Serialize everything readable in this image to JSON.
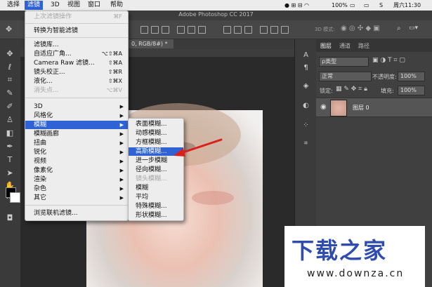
{
  "menubar": {
    "items": [
      "选择",
      "滤镜",
      "3D",
      "视图",
      "窗口",
      "帮助"
    ],
    "status": {
      "battery": "100%",
      "clock": "周六11:30"
    }
  },
  "window": {
    "title": "Adobe Photoshop CC 2017"
  },
  "optionsbar": {
    "mode3d": "3D 模式:"
  },
  "document": {
    "tab_label": "0, RGB/8#) *"
  },
  "filter_menu": {
    "items": [
      {
        "label": "上次滤镜操作",
        "shortcut": "⌘F",
        "state": "disabled"
      },
      {
        "label": "转换为智能滤镜",
        "state": "normal"
      },
      {
        "label": "滤镜库...",
        "state": "normal"
      },
      {
        "label": "自适应广角...",
        "shortcut": "⌥⇧⌘A",
        "state": "normal"
      },
      {
        "label": "Camera Raw 滤镜...",
        "shortcut": "⇧⌘A",
        "state": "normal"
      },
      {
        "label": "镜头校正...",
        "shortcut": "⇧⌘R",
        "state": "normal"
      },
      {
        "label": "液化...",
        "shortcut": "⇧⌘X",
        "state": "normal"
      },
      {
        "label": "消失点...",
        "shortcut": "⌥⌘V",
        "state": "disabled"
      },
      {
        "label": "3D",
        "submenu": true,
        "state": "normal"
      },
      {
        "label": "风格化",
        "submenu": true,
        "state": "normal"
      },
      {
        "label": "模糊",
        "submenu": true,
        "state": "selected"
      },
      {
        "label": "模糊画廊",
        "submenu": true,
        "state": "normal"
      },
      {
        "label": "扭曲",
        "submenu": true,
        "state": "normal"
      },
      {
        "label": "锐化",
        "submenu": true,
        "state": "normal"
      },
      {
        "label": "视频",
        "submenu": true,
        "state": "normal"
      },
      {
        "label": "像素化",
        "submenu": true,
        "state": "normal"
      },
      {
        "label": "渲染",
        "submenu": true,
        "state": "normal"
      },
      {
        "label": "杂色",
        "submenu": true,
        "state": "normal"
      },
      {
        "label": "其它",
        "submenu": true,
        "state": "normal"
      },
      {
        "label": "浏览联机滤镜...",
        "state": "normal"
      }
    ]
  },
  "blur_menu": {
    "items": [
      {
        "label": "表面模糊...",
        "state": "normal"
      },
      {
        "label": "动感模糊...",
        "state": "normal"
      },
      {
        "label": "方框模糊...",
        "state": "normal"
      },
      {
        "label": "高斯模糊...",
        "state": "selected"
      },
      {
        "label": "进一步模糊",
        "state": "normal"
      },
      {
        "label": "径向模糊...",
        "state": "normal"
      },
      {
        "label": "镜头模糊...",
        "state": "disabled"
      },
      {
        "label": "模糊",
        "state": "normal"
      },
      {
        "label": "平均",
        "state": "normal"
      },
      {
        "label": "特殊模糊...",
        "state": "normal"
      },
      {
        "label": "形状模糊...",
        "state": "normal"
      }
    ]
  },
  "layers_panel": {
    "tabs": [
      "图层",
      "通道",
      "路径"
    ],
    "kind_filter": "ρ类型",
    "blend_mode": "正常",
    "opacity_label": "不透明度:",
    "opacity": "100%",
    "lock_label": "锁定:",
    "fill_label": "填充:",
    "fill": "100%",
    "layer_name": "图层 0"
  },
  "watermark": {
    "title": "下载之家",
    "url": "www.downza.cn"
  },
  "colors": {
    "menu_highlight": "#2f62d4",
    "watermark_blue": "#2f4db0",
    "arrow_red": "#d9201a"
  }
}
